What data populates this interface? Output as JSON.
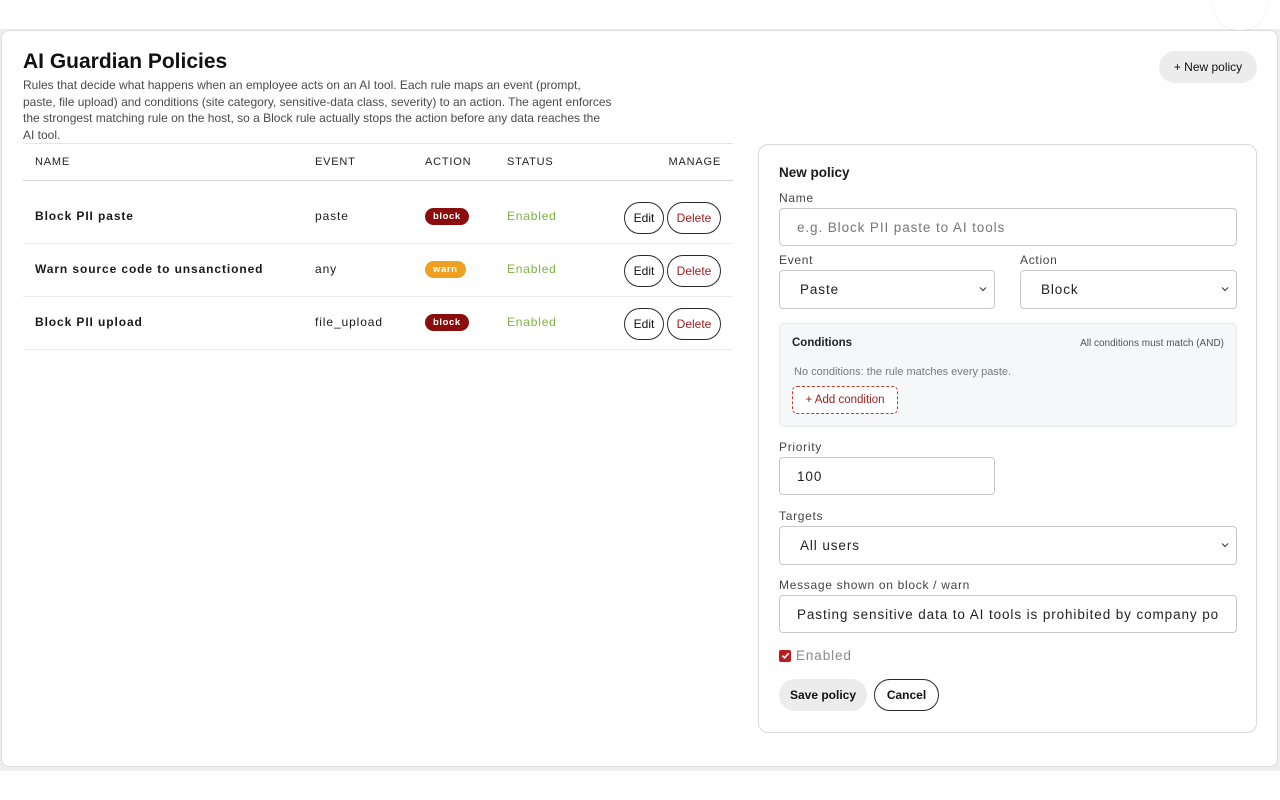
{
  "page": {
    "title": "AI Guardian Policies",
    "description": "Rules that decide what happens when an employee acts on an AI tool. Each rule maps an event (prompt, paste, file upload) and conditions (site category, sensitive-data class, severity) to an action. The agent enforces the strongest matching rule on the host, so a Block rule actually stops the action before any data reaches the AI tool.",
    "new_policy_label": "+ New policy"
  },
  "table": {
    "columns": [
      "NAME",
      "EVENT",
      "ACTION",
      "STATUS",
      "MANAGE"
    ],
    "rows": [
      {
        "name": "Block PII paste",
        "event": "paste",
        "action": "block",
        "status": "Enabled",
        "edit": "Edit",
        "delete": "Delete"
      },
      {
        "name": "Warn source code to unsanctioned",
        "event": "any",
        "action": "warn",
        "status": "Enabled",
        "edit": "Edit",
        "delete": "Delete"
      },
      {
        "name": "Block PII upload",
        "event": "file_upload",
        "action": "block",
        "status": "Enabled",
        "edit": "Edit",
        "delete": "Delete"
      }
    ]
  },
  "form": {
    "title": "New policy",
    "name_label": "Name",
    "name_placeholder": "e.g. Block PII paste to AI tools",
    "event_label": "Event",
    "event_value": "Paste",
    "action_label": "Action",
    "action_value": "Block",
    "conditions": {
      "title": "Conditions",
      "note": "All conditions must match (AND)",
      "empty_text": "No conditions: the rule matches every paste.",
      "add_label": "+ Add condition"
    },
    "priority_label": "Priority",
    "priority_value": "100",
    "targets_label": "Targets",
    "targets_value": "All users",
    "message_label": "Message shown on block / warn",
    "message_value": "Pasting sensitive data to AI tools is prohibited by company policy",
    "enabled_label": "Enabled",
    "enabled_checked": true,
    "save_label": "Save policy",
    "cancel_label": "Cancel"
  },
  "colors": {
    "block_badge": "#8b0c0c",
    "warn_badge": "#f0a020",
    "enabled_status": "#7cb342",
    "delete_text": "#9b1c1c",
    "checkbox": "#b91c1c"
  }
}
